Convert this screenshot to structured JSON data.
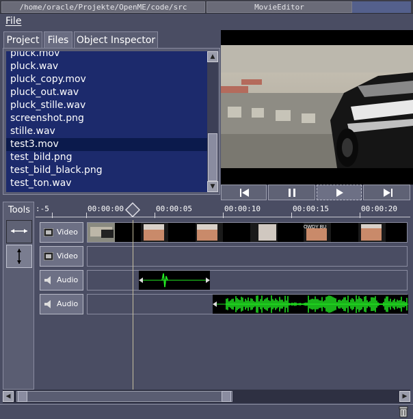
{
  "window": {
    "path_title": "/home/oracle/Projekte/OpenME/code/src",
    "app_title": "MovieEditor"
  },
  "menu": {
    "file": "File"
  },
  "tabs": [
    "Project",
    "Files",
    "Object Inspector"
  ],
  "files": [
    "pluck.mov",
    "pluck.wav",
    "pluck_copy.mov",
    "pluck_out.wav",
    "pluck_stille.wav",
    "screenshot.png",
    "stille.wav",
    "test3.mov",
    "test_bild.png",
    "test_bild_black.png",
    "test_ton.wav"
  ],
  "selected_file": "test3.mov",
  "player_controls": [
    "skip-start-icon",
    "pause-icon",
    "play-icon",
    "skip-end-icon"
  ],
  "tools": {
    "label": "Tools",
    "items": [
      "horizontal-move-icon",
      "vertical-move-icon"
    ]
  },
  "ruler": {
    "labels": [
      ":-5",
      "00:00:00",
      "00:00:05",
      "00:00:10",
      "00:00:15",
      "00:00:20"
    ]
  },
  "tracks": [
    {
      "kind": "video",
      "label": "Video"
    },
    {
      "kind": "video",
      "label": "Video"
    },
    {
      "kind": "audio",
      "label": "Audio"
    },
    {
      "kind": "audio",
      "label": "Audio"
    }
  ],
  "thumbnail_text": "OWDY BU",
  "colors": {
    "list_bg": "#1c2a6c",
    "selection": "#0b1a4c",
    "waveform": "#22ee22",
    "panel": "#4a4d63"
  }
}
